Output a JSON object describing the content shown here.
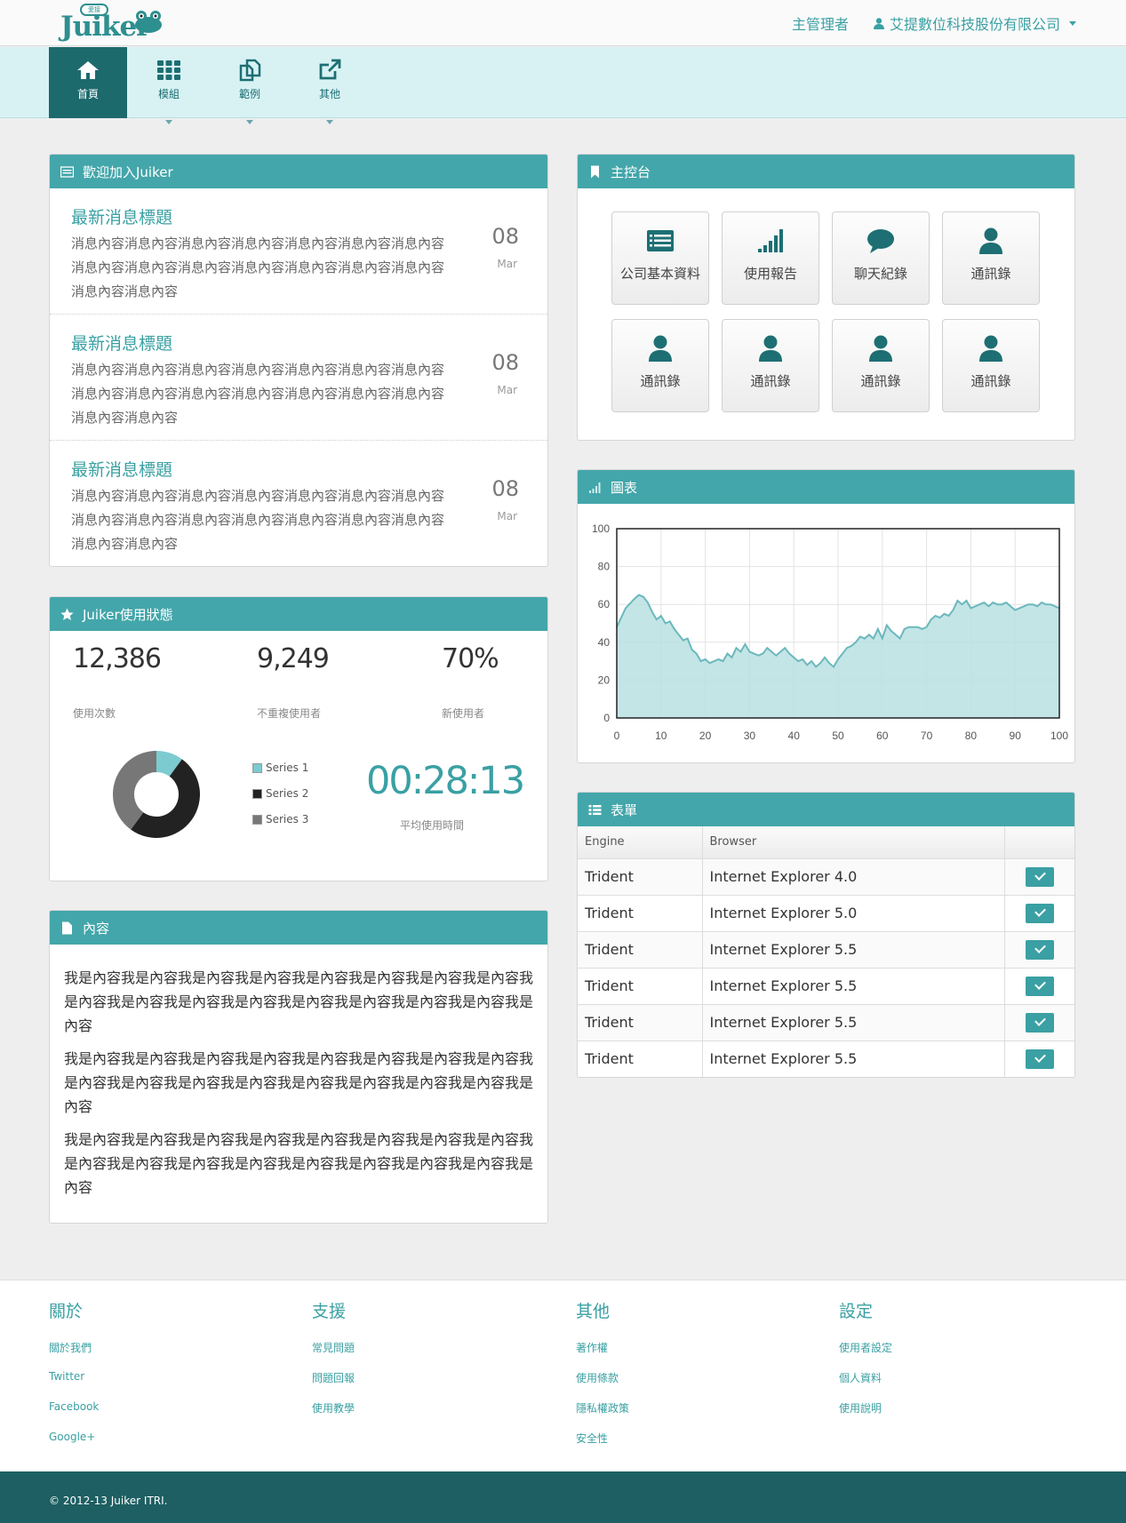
{
  "app": {
    "logo_text": "Juiker",
    "logo_badge": "愛接"
  },
  "header": {
    "admin_label": "主管理者",
    "company_label": "艾提數位科技股份有限公司"
  },
  "nav": [
    {
      "label": "首頁",
      "icon": "home-icon",
      "active": true
    },
    {
      "label": "模組",
      "icon": "grid-icon",
      "active": false
    },
    {
      "label": "範例",
      "icon": "copy-icon",
      "active": false
    },
    {
      "label": "其他",
      "icon": "external-link-icon",
      "active": false
    }
  ],
  "welcome": {
    "title": "歡迎加入Juiker",
    "items": [
      {
        "title": "最新消息標題",
        "body": "消息內容消息內容消息內容消息內容消息內容消息內容消息內容消息內容消息內容消息內容消息內容消息內容消息內容消息內容消息內容消息內容",
        "day": "08",
        "month": "Mar"
      },
      {
        "title": "最新消息標題",
        "body": "消息內容消息內容消息內容消息內容消息內容消息內容消息內容消息內容消息內容消息內容消息內容消息內容消息內容消息內容消息內容消息內容",
        "day": "08",
        "month": "Mar"
      },
      {
        "title": "最新消息標題",
        "body": "消息內容消息內容消息內容消息內容消息內容消息內容消息內容消息內容消息內容消息內容消息內容消息內容消息內容消息內容消息內容消息內容",
        "day": "08",
        "month": "Mar"
      }
    ]
  },
  "status": {
    "title": "Juiker使用狀態",
    "stats": [
      {
        "value": "12,386",
        "label": "使用次數"
      },
      {
        "value": "9,249",
        "label": "不重複使用者"
      },
      {
        "value": "70%",
        "label": "新使用者"
      }
    ],
    "legend": [
      "Series 1",
      "Series 2",
      "Series 3"
    ],
    "donut": [
      {
        "value": 10,
        "color": "#7ccbd0"
      },
      {
        "value": 50,
        "color": "#222222"
      },
      {
        "value": 40,
        "color": "#777777"
      }
    ],
    "timer": "00:28:13",
    "timer_label": "平均使用時間"
  },
  "content": {
    "title": "內容",
    "paragraphs": [
      "我是內容我是內容我是內容我是內容我是內容我是內容我是內容我是內容我是內容我是內容我是內容我是內容我是內容我是內容我是內容我是內容我是內容",
      "我是內容我是內容我是內容我是內容我是內容我是內容我是內容我是內容我是內容我是內容我是內容我是內容我是內容我是內容我是內容我是內容我是內容",
      "我是內容我是內容我是內容我是內容我是內容我是內容我是內容我是內容我是內容我是內容我是內容我是內容我是內容我是內容我是內容我是內容我是內容"
    ]
  },
  "console": {
    "title": "主控台",
    "tiles": [
      {
        "label": "公司基本資料",
        "icon": "list-icon"
      },
      {
        "label": "使用報告",
        "icon": "signal-icon"
      },
      {
        "label": "聊天紀錄",
        "icon": "chat-icon"
      },
      {
        "label": "通訊錄",
        "icon": "user-icon"
      },
      {
        "label": "通訊錄",
        "icon": "user-icon"
      },
      {
        "label": "通訊錄",
        "icon": "user-icon"
      },
      {
        "label": "通訊錄",
        "icon": "user-icon"
      },
      {
        "label": "通訊錄",
        "icon": "user-icon"
      }
    ]
  },
  "chart_panel": {
    "title": "圖表"
  },
  "chart_data": {
    "type": "area",
    "xlim": [
      0,
      100
    ],
    "ylim": [
      0,
      100
    ],
    "xticks": [
      0,
      10,
      20,
      30,
      40,
      50,
      60,
      70,
      80,
      90,
      100
    ],
    "yticks": [
      0,
      20,
      40,
      60,
      80,
      100
    ],
    "grid": true,
    "fill_color": "#b9e0e2",
    "line_color": "#6bb8bd",
    "x": [
      0,
      2,
      4,
      5,
      6,
      7,
      8,
      9,
      10,
      11,
      12,
      13,
      14,
      15,
      16,
      17,
      18,
      19,
      20,
      21,
      22,
      23,
      24,
      25,
      26,
      27,
      28,
      29,
      30,
      31,
      32,
      33,
      34,
      35,
      36,
      37,
      38,
      39,
      40,
      41,
      42,
      43,
      44,
      45,
      46,
      47,
      48,
      49,
      50,
      51,
      52,
      53,
      54,
      55,
      56,
      57,
      58,
      59,
      60,
      61,
      62,
      63,
      64,
      65,
      66,
      67,
      68,
      69,
      70,
      71,
      72,
      73,
      74,
      75,
      76,
      77,
      78,
      79,
      80,
      81,
      82,
      83,
      84,
      85,
      86,
      87,
      88,
      89,
      90,
      91,
      92,
      93,
      94,
      95,
      96,
      97,
      98,
      99,
      100
    ],
    "y": [
      48,
      58,
      63,
      65,
      64,
      61,
      56,
      52,
      54,
      50,
      51,
      47,
      44,
      41,
      42,
      36,
      34,
      30,
      31,
      29,
      30,
      31,
      30,
      34,
      32,
      37,
      35,
      39,
      35,
      34,
      33,
      34,
      37,
      35,
      33,
      35,
      37,
      34,
      32,
      30,
      31,
      28,
      30,
      27,
      29,
      32,
      29,
      27,
      31,
      34,
      37,
      38,
      40,
      43,
      42,
      44,
      42,
      47,
      42,
      49,
      46,
      44,
      42,
      47,
      48,
      48,
      48,
      47,
      48,
      52,
      54,
      53,
      55,
      54,
      57,
      62,
      60,
      62,
      58,
      59,
      60,
      61,
      59,
      61,
      60,
      60,
      61,
      59,
      57,
      58,
      59,
      60,
      60,
      59,
      61,
      60,
      60,
      59,
      58
    ]
  },
  "table": {
    "title": "表單",
    "headers": [
      "Engine",
      "Browser",
      ""
    ],
    "rows": [
      [
        "Trident",
        "Internet Explorer 4.0"
      ],
      [
        "Trident",
        "Internet Explorer 5.0"
      ],
      [
        "Trident",
        "Internet Explorer 5.5"
      ],
      [
        "Trident",
        "Internet Explorer 5.5"
      ],
      [
        "Trident",
        "Internet Explorer 5.5"
      ],
      [
        "Trident",
        "Internet Explorer 5.5"
      ]
    ]
  },
  "footer": {
    "columns": [
      {
        "title": "關於",
        "links": [
          "關於我們",
          "Twitter",
          "Facebook",
          "Google+"
        ]
      },
      {
        "title": "支援",
        "links": [
          "常見問題",
          "問題回報",
          "使用教學"
        ]
      },
      {
        "title": "其他",
        "links": [
          "著作權",
          "使用條款",
          "隱私權政策",
          "安全性"
        ]
      },
      {
        "title": "設定",
        "links": [
          "使用者設定",
          "個人資料",
          "使用說明"
        ]
      }
    ],
    "copyright": "© 2012-13 Juiker ITRI."
  }
}
